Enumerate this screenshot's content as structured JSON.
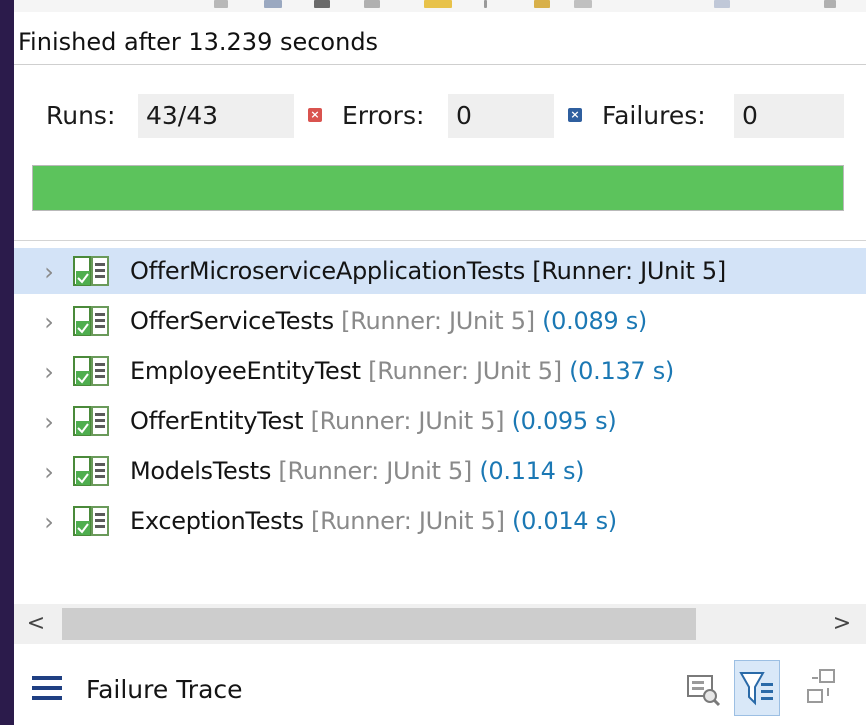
{
  "status": {
    "finished_text": "Finished after 13.239 seconds"
  },
  "counters": {
    "runs_label": "Runs:",
    "runs_value": "43/43",
    "errors_label": "Errors:",
    "errors_value": "0",
    "failures_label": "Failures:",
    "failures_value": "0"
  },
  "progress": {
    "fraction": 1.0,
    "color": "#5cc35c"
  },
  "tests": [
    {
      "name": "OfferMicroserviceApplicationTests",
      "runner": "[Runner: JUnit 5]",
      "time": "",
      "selected": true,
      "icon": "test-suite-passed-icon"
    },
    {
      "name": "OfferServiceTests",
      "runner": "[Runner: JUnit 5]",
      "time": "(0.089 s)",
      "selected": false,
      "icon": "test-suite-passed-icon"
    },
    {
      "name": "EmployeeEntityTest",
      "runner": "[Runner: JUnit 5]",
      "time": "(0.137 s)",
      "selected": false,
      "icon": "test-suite-passed-icon"
    },
    {
      "name": "OfferEntityTest",
      "runner": "[Runner: JUnit 5]",
      "time": "(0.095 s)",
      "selected": false,
      "icon": "test-suite-passed-icon"
    },
    {
      "name": "ModelsTests",
      "runner": "[Runner: JUnit 5]",
      "time": "(0.114 s)",
      "selected": false,
      "icon": "test-suite-passed-icon"
    },
    {
      "name": "ExceptionTests",
      "runner": "[Runner: JUnit 5]",
      "time": "(0.014 s)",
      "selected": false,
      "icon": "test-suite-passed-icon"
    }
  ],
  "scrollbar": {
    "left_arrow": "<",
    "right_arrow": ">"
  },
  "failure_trace": {
    "label": "Failure Trace"
  },
  "colors": {
    "success": "#5cc35c",
    "error": "#d9534f",
    "failure": "#2f5f9f",
    "selection": "#d3e3f7",
    "time": "#1b78b4",
    "runner": "#8a8a8a"
  }
}
